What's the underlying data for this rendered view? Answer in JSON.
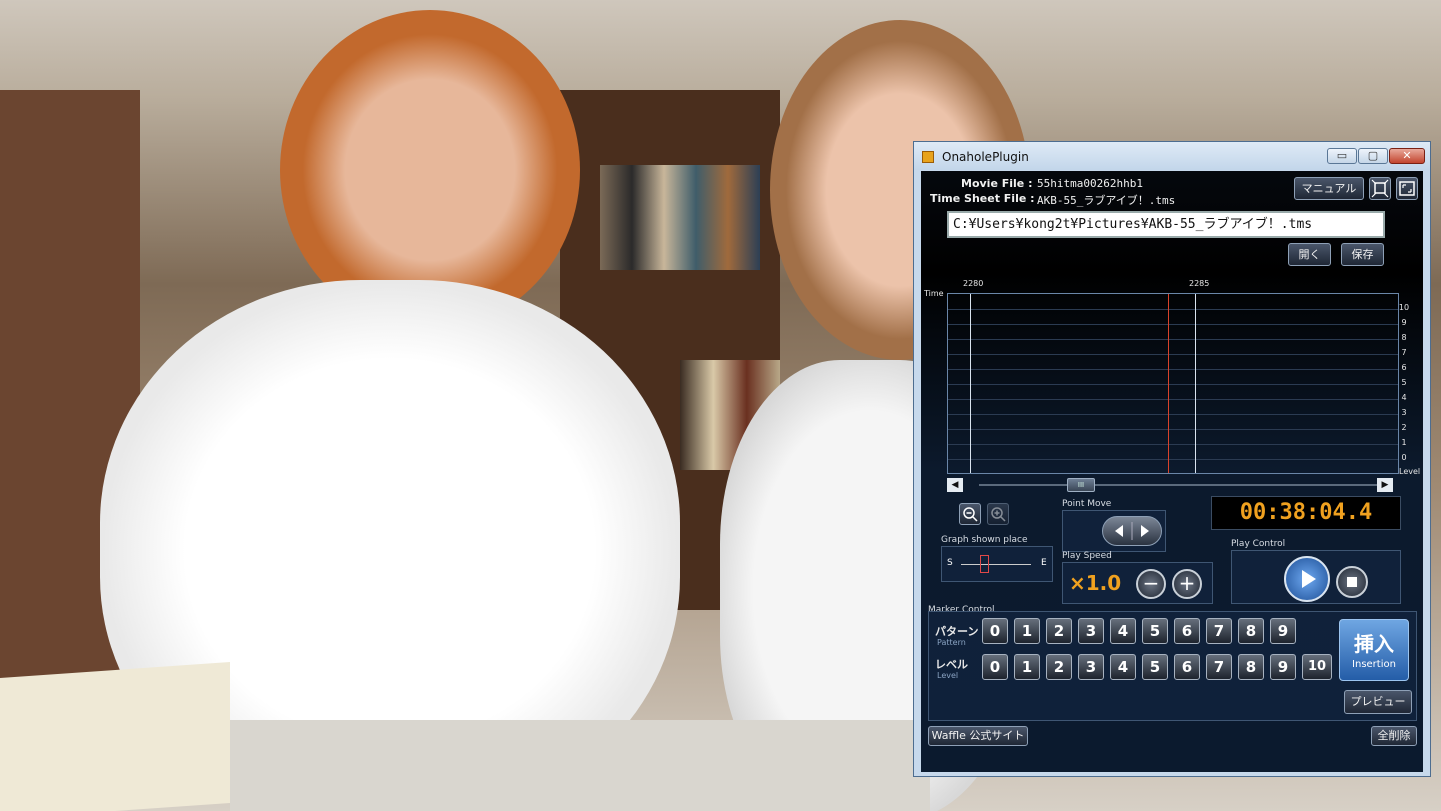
{
  "window": {
    "title": "OnaholePlugin",
    "minimize_glyph": "▭",
    "maximize_glyph": "▢",
    "close_glyph": "✕"
  },
  "files": {
    "movie_label": "Movie File :",
    "movie_value": "55hitma00262hhb1",
    "timesheet_label": "Time Sheet File :",
    "timesheet_value": "AKB-55_ラブアイブ！.tms",
    "path": "C:¥Users¥kong2t¥Pictures¥AKB-55_ラブアイブ！.tms"
  },
  "buttons": {
    "manual": "マニュアル",
    "open": "開く",
    "save": "保存",
    "preview": "プレビュー",
    "waffle": "Waffle 公式サイト",
    "clear_all": "全削除",
    "insert": "挿入",
    "insert_sub": "Insertion"
  },
  "graph": {
    "time_label": "Time",
    "level_label": "Level",
    "time_marks": [
      "2280",
      "2285"
    ],
    "y_ticks": [
      "10",
      "9",
      "8",
      "7",
      "6",
      "5",
      "4",
      "3",
      "2",
      "1",
      "0"
    ],
    "scroll_thumb": "III"
  },
  "controls": {
    "point_move": "Point Move",
    "graph_place": "Graph shown place",
    "graph_place_start": "S",
    "graph_place_end": "E",
    "play_speed": "Play Speed",
    "speed_value": "×1.0",
    "play_control": "Play Control",
    "timecode": "00:38:04.4"
  },
  "marker": {
    "title": "Marker Control",
    "pattern_label": "パターン",
    "pattern_sub": "Pattern",
    "level_label": "レベル",
    "level_sub": "Level",
    "pattern_values": [
      "0",
      "1",
      "2",
      "3",
      "4",
      "5",
      "6",
      "7",
      "8",
      "9"
    ],
    "level_values": [
      "0",
      "1",
      "2",
      "3",
      "4",
      "5",
      "6",
      "7",
      "8",
      "9",
      "10"
    ]
  },
  "colors": {
    "timecode": "#f0a11f",
    "playhead": "#d9432b",
    "accent": "#245da8"
  }
}
